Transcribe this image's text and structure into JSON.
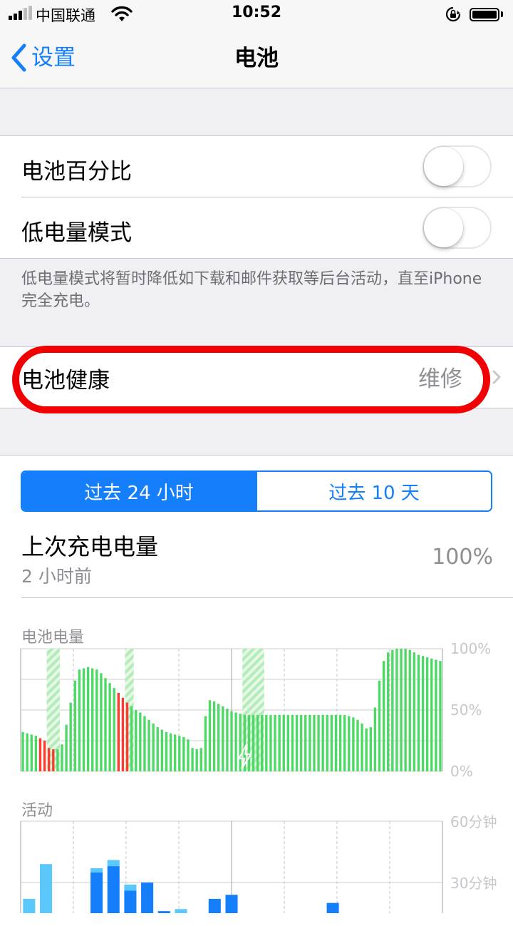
{
  "status_bar": {
    "carrier": "中国联通",
    "time": "10:52",
    "icons": [
      "signal-icon",
      "wifi-icon",
      "orientation-lock-icon",
      "battery-icon"
    ]
  },
  "nav": {
    "back_label": "设置",
    "title": "电池"
  },
  "settings": {
    "battery_percentage_label": "电池百分比",
    "battery_percentage_on": false,
    "low_power_label": "低电量模式",
    "low_power_on": false,
    "low_power_note": "低电量模式将暂时降低如下载和邮件获取等后台活动，直至iPhone 完全充电。",
    "battery_health_label": "电池健康",
    "battery_health_value": "维修"
  },
  "usage": {
    "tabs": [
      "过去 24 小时",
      "过去 10 天"
    ],
    "selected_tab": 0,
    "last_charge_title": "上次充电电量",
    "last_charge_time": "2 小时前",
    "last_charge_value": "100%"
  },
  "colors": {
    "accent": "#147efb",
    "battery_green": "#4cd964",
    "battery_low_red": "#ff3b30",
    "charging_hatch": "#b4ecb9",
    "activity_screen_on": "#147efb",
    "activity_screen_off": "#5ac8fa",
    "annotation_red": "#f00000"
  },
  "chart_data": [
    {
      "type": "bar",
      "title": "电池电量",
      "y_tick_labels": [
        "100%",
        "50%",
        "0%"
      ],
      "ylim": [
        0,
        100
      ],
      "charging_periods": [
        [
          6,
          9
        ],
        [
          24,
          26
        ],
        [
          51,
          56
        ]
      ],
      "low_battery_bars": [
        4,
        5,
        6,
        7,
        22,
        23,
        24
      ],
      "charging_marker_bar": 51,
      "values": [
        32,
        31,
        30,
        29,
        27,
        25,
        19,
        18,
        18,
        22,
        38,
        56,
        74,
        83,
        84,
        85,
        84,
        83,
        80,
        76,
        72,
        68,
        64,
        60,
        56,
        53,
        50,
        48,
        45,
        42,
        39,
        36,
        34,
        32,
        31,
        30,
        29,
        28,
        26,
        19,
        18,
        19,
        45,
        58,
        57,
        55,
        53,
        51,
        49,
        48,
        47,
        46,
        46,
        46,
        46,
        46,
        46,
        46,
        46,
        46,
        46,
        46,
        46,
        46,
        46,
        46,
        46,
        46,
        46,
        46,
        46,
        46,
        46,
        46,
        46,
        45,
        44,
        42,
        39,
        35,
        36,
        52,
        74,
        90,
        97,
        99,
        100,
        100,
        100,
        99,
        97,
        95,
        94,
        93,
        92,
        91,
        90
      ]
    },
    {
      "type": "bar",
      "title": "活动",
      "y_tick_labels": [
        "60分钟",
        "30分钟"
      ],
      "ylim": [
        0,
        60
      ],
      "series": [
        {
          "name": "screen_on",
          "values": [
            12,
            0,
            2,
            8,
            35,
            38,
            26,
            30,
            16,
            15,
            14,
            22,
            24,
            9,
            0,
            0,
            0,
            0,
            20,
            14,
            0,
            0,
            10,
            10,
            6
          ]
        },
        {
          "name": "screen_off",
          "values": [
            10,
            39,
            3,
            0,
            2,
            3,
            3,
            0,
            0,
            2,
            0,
            0,
            0,
            0,
            0,
            0,
            0,
            0,
            0,
            0,
            0,
            0,
            0,
            0,
            0
          ]
        }
      ]
    }
  ]
}
